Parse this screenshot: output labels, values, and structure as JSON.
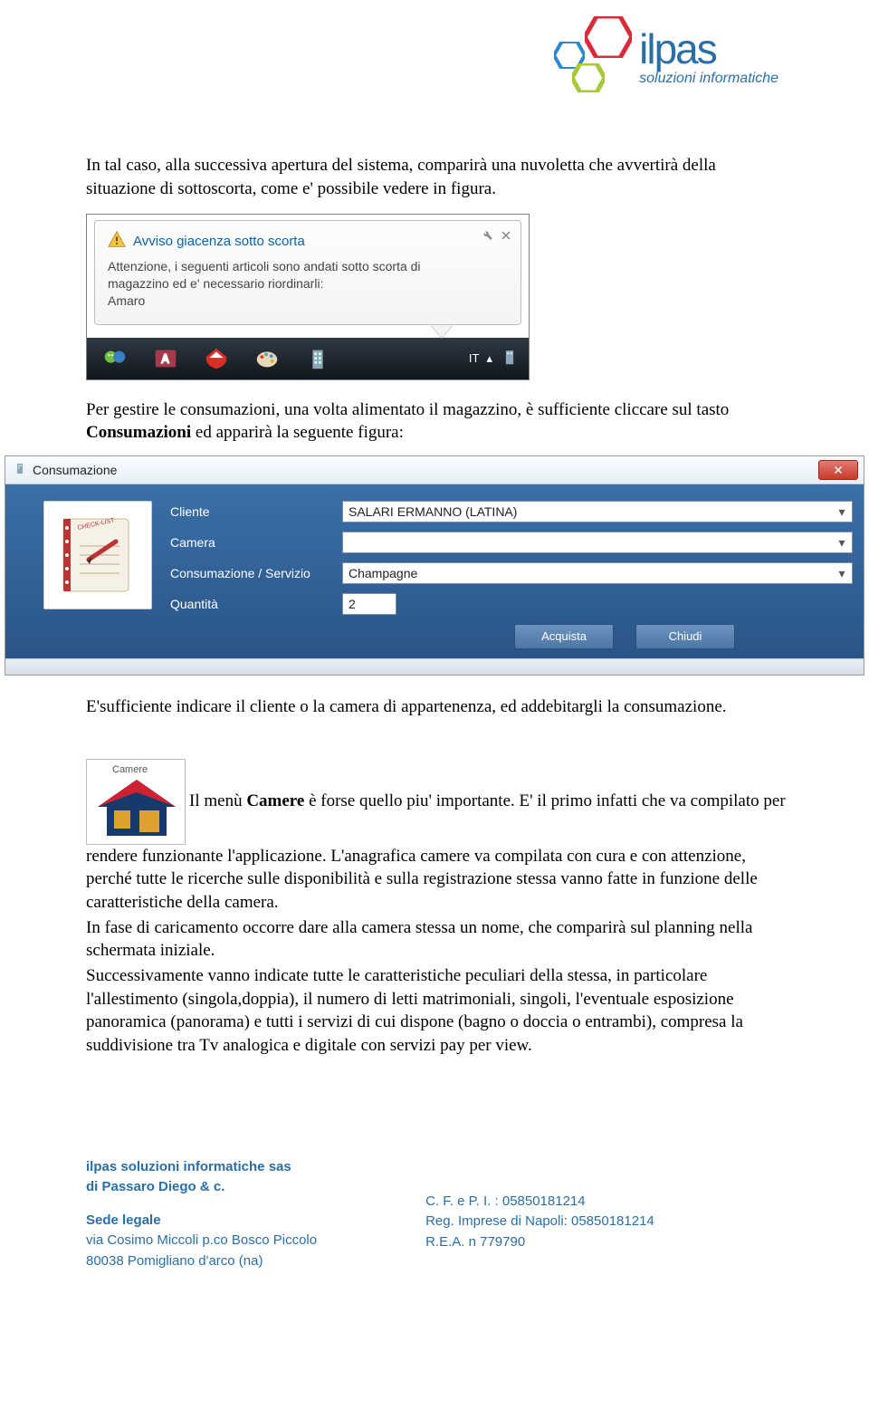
{
  "logo": {
    "main": "ilpas",
    "sub": "soluzioni informatiche"
  },
  "para1": "In tal caso, alla successiva apertura del sistema, comparirà una nuvoletta che avvertirà della situazione di sottoscorta, come e' possibile vedere in figura.",
  "notif": {
    "title": "Avviso giacenza sotto scorta",
    "line1": "Attenzione, i seguenti articoli sono andati sotto scorta di",
    "line2": "magazzino ed e' necessario riordinarli:",
    "line3": "Amaro"
  },
  "taskbar": {
    "lang": "IT"
  },
  "para2_a": "Per gestire le consumazioni, una volta alimentato il magazzino, è sufficiente cliccare sul tasto ",
  "para2_b": "Consumazioni",
  "para2_c": " ed apparirà la seguente figura:",
  "dialog": {
    "title": "Consumazione",
    "labels": {
      "cliente": "Cliente",
      "camera": "Camera",
      "servizio": "Consumazione / Servizio",
      "quantita": "Quantità"
    },
    "values": {
      "cliente": "SALARI ERMANNO (LATINA)",
      "camera": "",
      "servizio": "Champagne",
      "quantita": "2"
    },
    "buttons": {
      "acquista": "Acquista",
      "chiudi": "Chiudi"
    }
  },
  "para3": "E'sufficiente indicare il cliente o la camera di appartenenza, ed addebitargli la consumazione.",
  "camere_thumb_label": "Camere",
  "para4_a": "Il menù ",
  "para4_b": "Camere",
  "para4_c": " è forse quello piu' importante. E' il primo infatti che va compilato per rendere funzionante l'applicazione. L'anagrafica camere va compilata con cura e con attenzione, perché tutte le ricerche sulle disponibilità e sulla registrazione stessa vanno fatte in funzione delle caratteristiche della camera.",
  "para5": "In fase di caricamento occorre dare alla camera stessa un nome, che comparirà sul planning nella schermata iniziale.",
  "para6": "Successivamente vanno indicate tutte le caratteristiche peculiari della stessa, in particolare l'allestimento (singola,doppia), il numero di letti matrimoniali, singoli, l'eventuale esposizione panoramica (panorama) e tutti i servizi di cui dispone (bagno o doccia o entrambi), compresa la suddivisione tra Tv analogica e digitale con servizi pay per view.",
  "footer": {
    "name": "ilpas soluzioni informatiche sas",
    "name2": "di Passaro Diego & c.",
    "sede_h": "Sede legale",
    "sede_l1": "via Cosimo Miccoli p.co Bosco Piccolo",
    "sede_l2": "80038 Pomigliano d'arco (na)",
    "cf": "C. F. e P. I. : 05850181214",
    "reg": "Reg. Imprese di Napoli: 05850181214",
    "rea": "R.E.A. n 779790"
  }
}
